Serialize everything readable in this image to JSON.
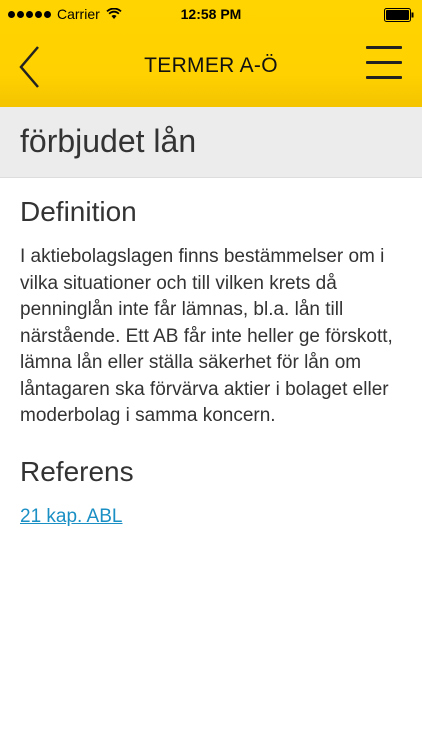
{
  "status_bar": {
    "carrier": "Carrier",
    "time": "12:58 PM"
  },
  "nav": {
    "title": "TERMER A-Ö",
    "back_icon": "chevron-left-icon",
    "menu_icon": "hamburger-menu-icon"
  },
  "term": {
    "title": "förbjudet lån"
  },
  "definition": {
    "heading": "Definition",
    "text": "I aktiebolagslagen finns bestämmelser om i vilka situationer och till vilken krets då penninglån inte får lämnas, bl.a. lån till närstående. Ett AB får inte heller ge förskott, lämna lån eller ställa säkerhet för lån om låntagaren ska förvärva aktier i bolaget eller moderbolag i samma koncern."
  },
  "reference": {
    "heading": "Referens",
    "link_text": "21 kap. ABL"
  },
  "colors": {
    "header_yellow": "#ffd400",
    "link_blue": "#1a8fc4",
    "term_bg": "#ececec"
  }
}
